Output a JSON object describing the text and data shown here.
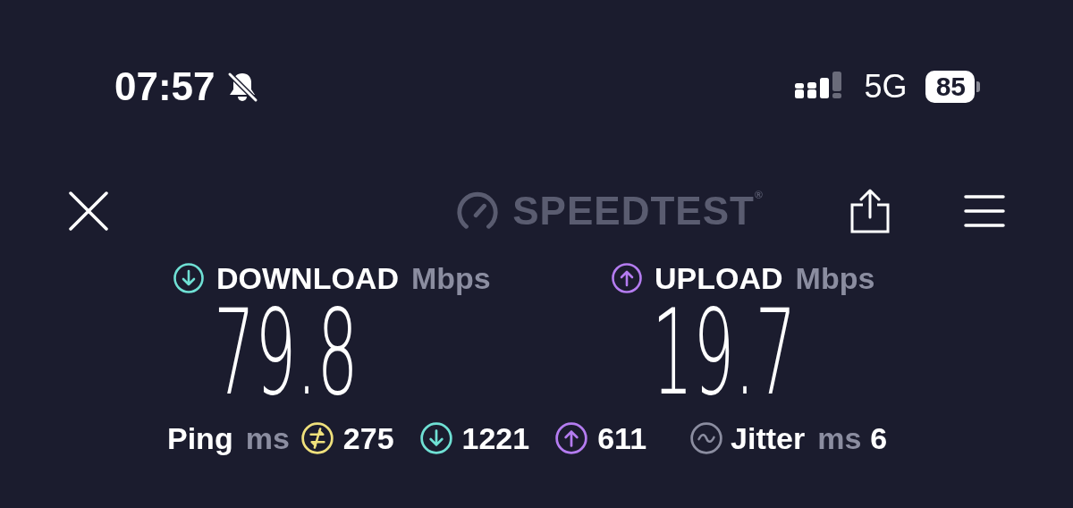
{
  "status_bar": {
    "time": "07:57",
    "network": "5G",
    "battery": "85"
  },
  "header": {
    "logo_text": "SPEEDTEST$^{®}$"
  },
  "results": [
    {
      "kind": "download",
      "label": "DOWNLOAD",
      "unit": "Mbps",
      "value": "79.8"
    },
    {
      "kind": "upload",
      "label": "UPLOAD",
      "unit": "Mbps",
      "value": "19.7"
    }
  ],
  "ping": {
    "label": "Ping",
    "unit": "ms",
    "readings": [
      {
        "kind": "idle",
        "value": "275"
      },
      {
        "kind": "download",
        "value": "1221"
      },
      {
        "kind": "upload",
        "value": "611"
      }
    ]
  },
  "jitter": {
    "label": "Jitter",
    "unit": "ms",
    "value": "6"
  }
}
